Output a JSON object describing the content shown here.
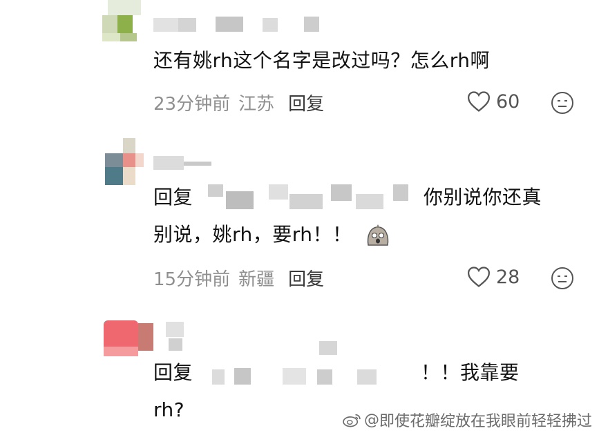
{
  "comments": [
    {
      "text": "还有姚rh这个名字是改过吗？怎么rh啊",
      "time": "23分钟前",
      "location": "江苏",
      "reply_label": "回复",
      "likes": "60"
    },
    {
      "reply_prefix": "回复",
      "text_line1": "你别说你还真",
      "text_line2": "别说，姚rh，要rh！！",
      "time": "15分钟前",
      "location": "新疆",
      "reply_label": "回复",
      "likes": "28"
    },
    {
      "reply_prefix": "回复",
      "text_line1": "！！我靠要",
      "text_line2": "rh?"
    }
  ],
  "watermark": {
    "prefix": "@",
    "text": "即使花瓣绽放在我眼前轻轻拂过"
  },
  "icons": {
    "like": "heart-outline-icon",
    "emoji": "neutral-face-icon",
    "sticker": "ghost-sticker-icon",
    "weibo": "weibo-logo-icon"
  },
  "colors": {
    "text": "#111111",
    "meta": "#8f8f8f",
    "background": "#ffffff"
  }
}
